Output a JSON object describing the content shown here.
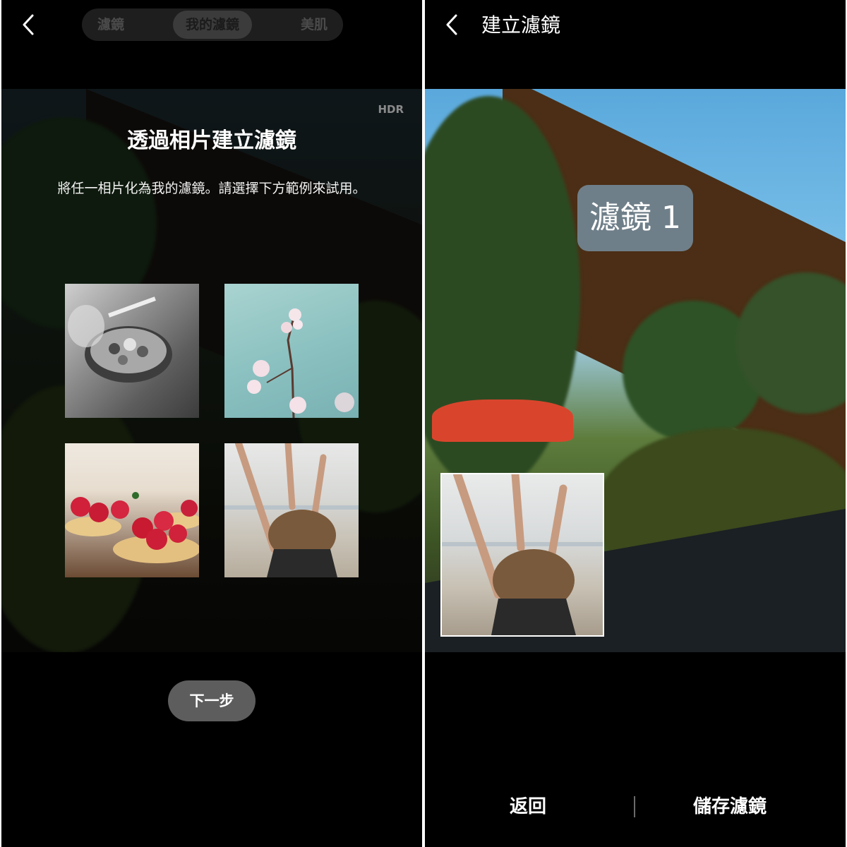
{
  "left": {
    "tabs": [
      {
        "label": "濾鏡",
        "active": false
      },
      {
        "label": "我的濾鏡",
        "active": true
      },
      {
        "label": "美肌",
        "active": false
      }
    ],
    "hdr_label": "HDR",
    "title": "透過相片建立濾鏡",
    "description": "將任一相片化為我的濾鏡。請選擇下方範例來試用。",
    "next_button": "下一步"
  },
  "right": {
    "title": "建立濾鏡",
    "filter_name": "濾鏡 1",
    "back_button": "返回",
    "save_button": "儲存濾鏡"
  },
  "colors": {
    "background": "#000000",
    "tab_bar": "#1e1e1e",
    "button": "#5d5d5d",
    "label_overlay": "rgba(130,170,200,0.65)"
  }
}
